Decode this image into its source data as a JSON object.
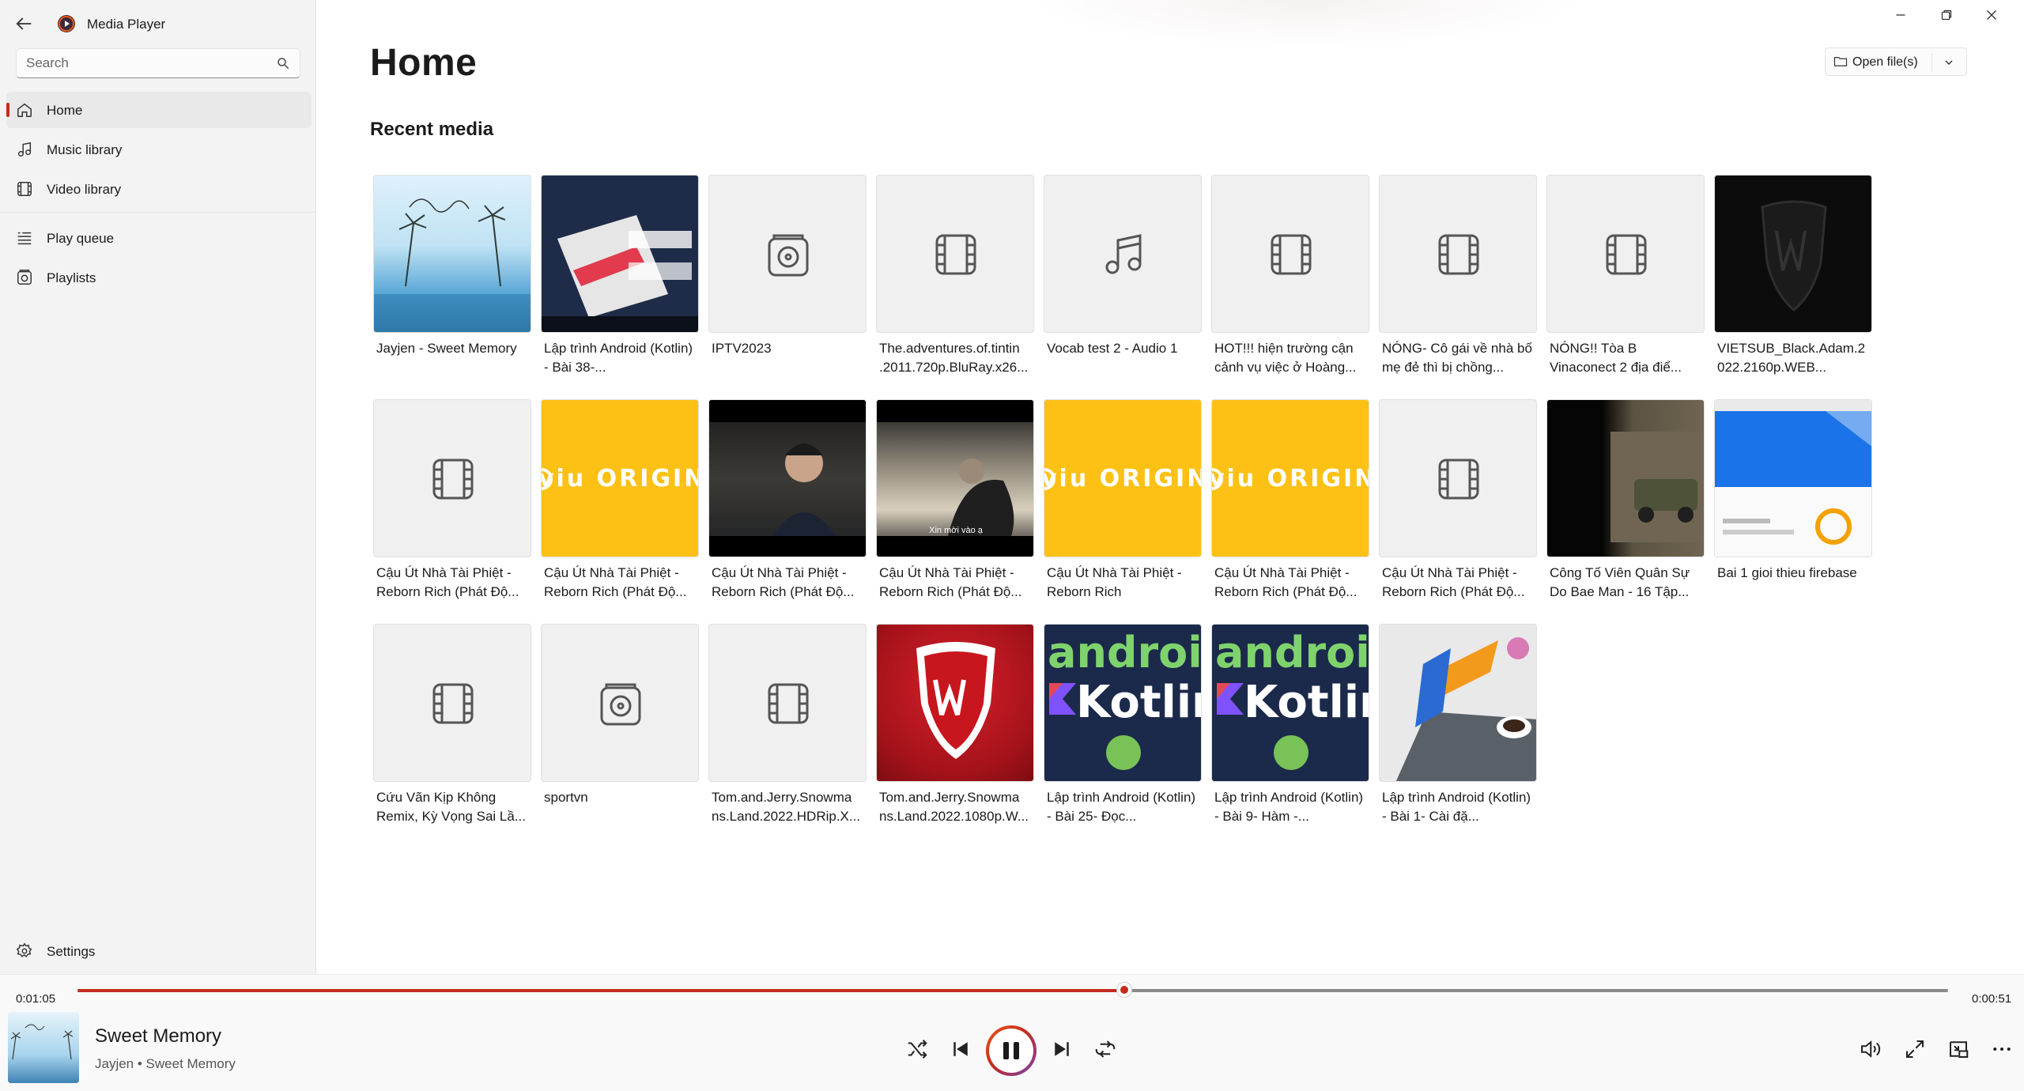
{
  "app": {
    "title": "Media Player"
  },
  "sidebar": {
    "search_placeholder": "Search",
    "items": [
      {
        "label": "Home",
        "icon": "home-icon",
        "active": true
      },
      {
        "label": "Music library",
        "icon": "music-note-icon"
      },
      {
        "label": "Video library",
        "icon": "film-icon"
      },
      {
        "label": "Play queue",
        "icon": "queue-icon"
      },
      {
        "label": "Playlists",
        "icon": "playlist-icon"
      }
    ],
    "settings_label": "Settings"
  },
  "main": {
    "title": "Home",
    "section": "Recent media",
    "open_button": "Open file(s)",
    "tiles": [
      {
        "title": "Jayjen - Sweet Memory",
        "thumb": "sweet-memory-art"
      },
      {
        "title": "Lập trình Android (Kotlin) - Bài 38-...",
        "thumb": "android-banner"
      },
      {
        "title": "IPTV2023",
        "thumb": "playlist-placeholder-icon"
      },
      {
        "title": "The.adventures.of.tintin .2011.720p.BluRay.x26...",
        "thumb": "film-placeholder-icon"
      },
      {
        "title": "Vocab test 2 - Audio 1",
        "thumb": "music-placeholder-icon"
      },
      {
        "title": "HOT!!! hiện trường cận cảnh vụ việc ở Hoàng...",
        "thumb": "film-placeholder-icon"
      },
      {
        "title": "NÓNG- Cô gái về nhà bố mẹ đẻ thì bị chồng...",
        "thumb": "film-placeholder-icon"
      },
      {
        "title": "NÓNG!! Tòa B Vinaconect 2 địa điể...",
        "thumb": "film-placeholder-icon"
      },
      {
        "title": "VIETSUB_Black.Adam.2 022.2160p.WEB...",
        "thumb": "wb-dark-logo"
      },
      {
        "title": "Cậu Út Nhà Tài Phiệt - Reborn Rich (Phát Độ...",
        "thumb": "film-placeholder-icon"
      },
      {
        "title": "Cậu Út Nhà Tài Phiệt - Reborn Rich (Phát Độ...",
        "thumb": "viu-original"
      },
      {
        "title": "Cậu Út Nhà Tài Phiệt - Reborn Rich (Phát Độ...",
        "thumb": "scene-man"
      },
      {
        "title": "Cậu Út Nhà Tài Phiệt - Reborn Rich (Phát Độ...",
        "thumb": "scene-subtitle"
      },
      {
        "title": "Cậu Út Nhà Tài Phiệt - Reborn Rich",
        "thumb": "viu-original"
      },
      {
        "title": "Cậu Út Nhà Tài Phiệt - Reborn Rich (Phát Độ...",
        "thumb": "viu-original"
      },
      {
        "title": "Cậu Út Nhà Tài Phiệt - Reborn Rich (Phát Độ...",
        "thumb": "film-placeholder-icon"
      },
      {
        "title": "Công Tố Viên Quân Sự Do Bae Man - 16 Tập...",
        "thumb": "scene-military"
      },
      {
        "title": "Bai 1 gioi thieu firebase",
        "thumb": "firebase-web"
      },
      {
        "title": "Cứu Vãn Kịp Không Remix, Kỳ Vọng Sai Lầ...",
        "thumb": "film-placeholder-icon"
      },
      {
        "title": "sportvn",
        "thumb": "playlist-placeholder-icon"
      },
      {
        "title": "Tom.and.Jerry.Snowma ns.Land.2022.HDRip.X...",
        "thumb": "film-placeholder-icon"
      },
      {
        "title": "Tom.and.Jerry.Snowma ns.Land.2022.1080p.W...",
        "thumb": "wb-animation"
      },
      {
        "title": "Lập trình Android (Kotlin) - Bài 25- Đọc...",
        "thumb": "android-kotlin"
      },
      {
        "title": "Lập trình Android (Kotlin) - Bài 9- Hàm -...",
        "thumb": "android-kotlin"
      },
      {
        "title": "Lập trình Android (Kotlin) - Bài 1- Cài đặ...",
        "thumb": "laptop-kotlin"
      }
    ],
    "thumb_text": {
      "viu": "viu ORIGINA",
      "android": "androic",
      "kotlin": "Kotlir",
      "subtitle_overlay": "Xin mời vào ạ"
    }
  },
  "player": {
    "elapsed": "0:01:05",
    "remaining": "0:00:51",
    "progress_fraction": 0.5598,
    "track_title": "Sweet Memory",
    "track_sub": "Jayjen • Sweet Memory",
    "accent": "#c42b1c"
  }
}
